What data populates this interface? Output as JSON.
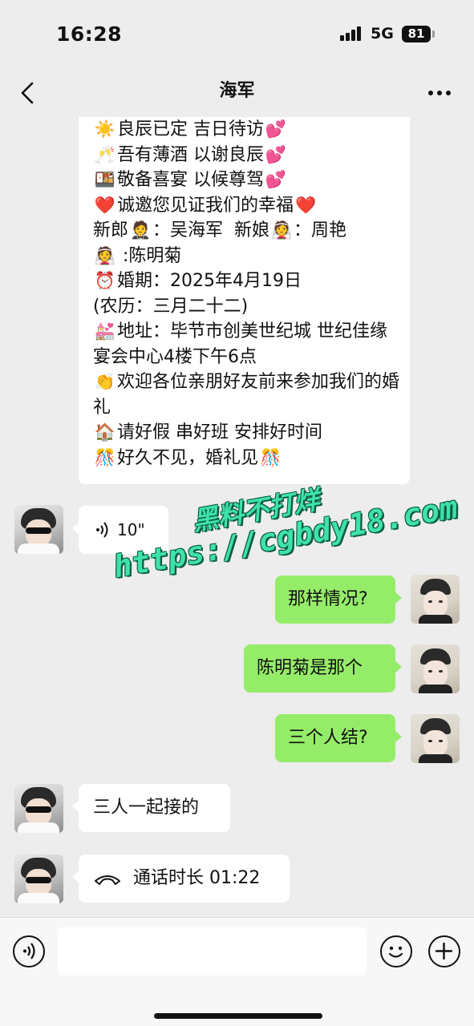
{
  "status_bar": {
    "time": "16:28",
    "network": "5G",
    "battery": "81"
  },
  "nav": {
    "title": "海军"
  },
  "invitation": {
    "lines": [
      {
        "icon": "☀️",
        "text": "良辰已定 吉日待访",
        "trail_icon": "💕"
      },
      {
        "icon": "🥂",
        "text": "吾有薄酒 以谢良辰",
        "trail_icon": "💕"
      },
      {
        "icon": "🍱",
        "text": "敬备喜宴 以候尊驾",
        "trail_icon": "💕"
      },
      {
        "icon": "❤️",
        "text": "诚邀您见证我们的幸福",
        "trail_icon": "❤️"
      }
    ],
    "groom_label": "新郎",
    "groom_icon": "🤵",
    "groom_name": "：吴海军",
    "bride_label": "新娘",
    "bride_icon": "👰",
    "bride_name": "：周艳",
    "extra_icon": "👰",
    "extra_name": ":陈明菊",
    "date_icon": "⏰",
    "date_text": "婚期：2025年4月19日",
    "lunar_text": "(农历：三月二十二)",
    "venue_icon": "💒",
    "venue_text": "地址：毕节市创美世纪城 世纪佳缘宴会中心4楼下午6点",
    "welcome_icon": "👏",
    "welcome_text": "欢迎各位亲朋好友前来参加我们的婚礼",
    "leave_icon": "🏠",
    "leave_text": "请好假 串好班 安排好时间",
    "see_icon": "🎊",
    "see_text": "好久不见，婚礼见",
    "see_trail_icon": "🎊"
  },
  "messages": {
    "voice_length": "10\"",
    "right_1": "那样情况?",
    "right_2": "陈明菊是那个",
    "right_3": "三个人结?",
    "left_1": "三人一起接的",
    "call_text": "通话时长 01:22"
  },
  "watermark": {
    "line1": "黑料不打烊",
    "line2": "https://cgbdy18.com"
  },
  "colors": {
    "background": "#ededed",
    "green_bubble": "#95ec69",
    "white_bubble": "#ffffff",
    "watermark": "#3fe2a8"
  },
  "icons": [
    "back-chevron-icon",
    "more-dots-icon",
    "voice-wave-icon",
    "phone-hangup-icon",
    "voice-toggle-icon",
    "emoji-icon",
    "plus-icon"
  ]
}
